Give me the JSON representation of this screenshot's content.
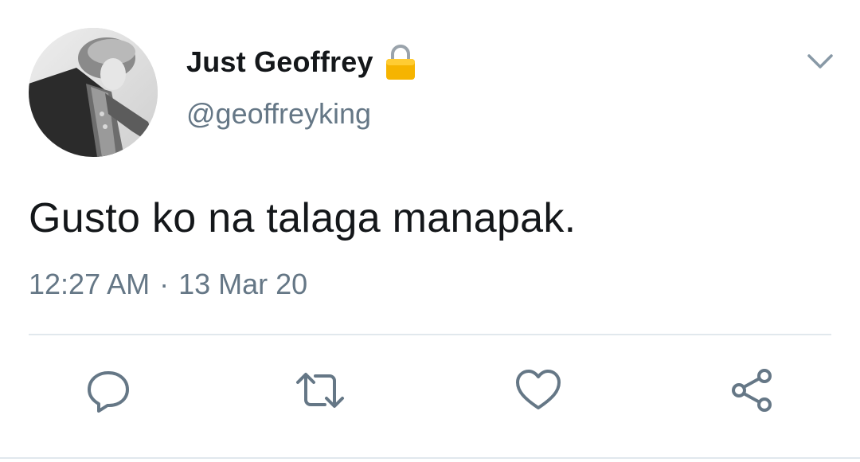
{
  "tweet": {
    "display_name": "Just Geoffrey",
    "handle": "@geoffreyking",
    "text": "Gusto ko na talaga manapak.",
    "time": "12:27 AM",
    "separator": "·",
    "date": "13 Mar 20",
    "protected_icon": "lock-icon",
    "menu_icon": "chevron-down-icon"
  },
  "actions": [
    {
      "name": "reply",
      "icon": "reply-icon"
    },
    {
      "name": "retweet",
      "icon": "retweet-icon"
    },
    {
      "name": "like",
      "icon": "heart-icon"
    },
    {
      "name": "share",
      "icon": "share-icon"
    }
  ],
  "colors": {
    "primary_text": "#14171a",
    "secondary_text": "#657786",
    "divider": "#e1e8ed",
    "lock": "#f4b400"
  }
}
